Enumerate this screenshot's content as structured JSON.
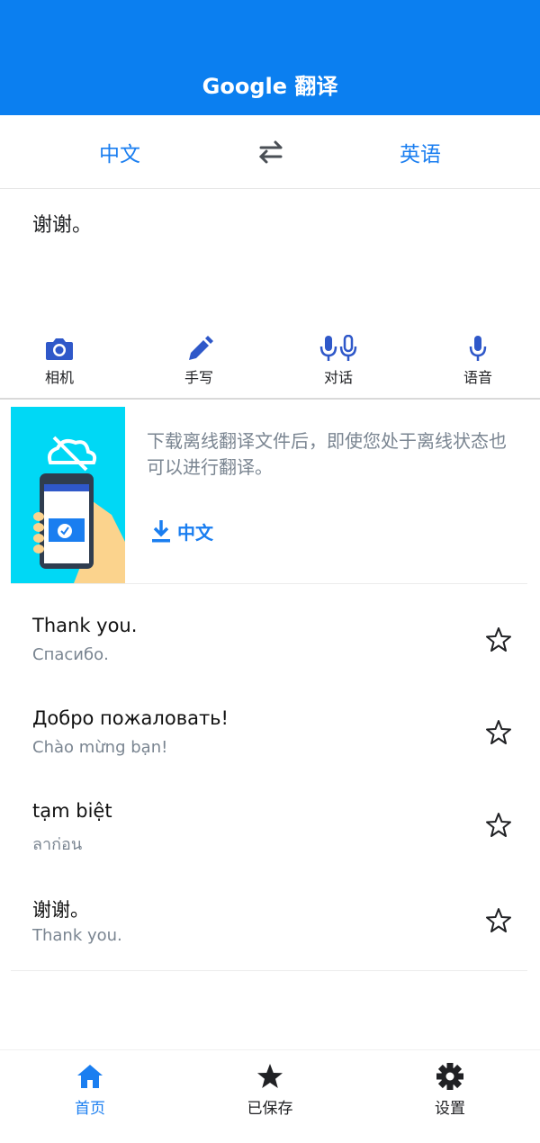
{
  "header": {
    "title": "Google 翻译",
    "color": "#0b7ff0"
  },
  "languages": {
    "source": "中文",
    "target": "英语"
  },
  "input": {
    "text": "谢谢。"
  },
  "tools": [
    {
      "label": "相机",
      "icon": "camera-icon"
    },
    {
      "label": "手写",
      "icon": "pen-icon"
    },
    {
      "label": "对话",
      "icon": "dual-mic-icon"
    },
    {
      "label": "语音",
      "icon": "mic-icon"
    }
  ],
  "offline": {
    "message": "下载离线翻译文件后，即使您处于离线状态也可以进行翻译。",
    "download_label": "中文",
    "icon": "download-icon"
  },
  "history": [
    {
      "source": "Thank you.",
      "translation": "Спасибо."
    },
    {
      "source": "Добро пожаловать!",
      "translation": "Chào mừng bạn!"
    },
    {
      "source": "tạm biệt",
      "translation": "ลาก่อน"
    },
    {
      "source": "谢谢。",
      "translation": "Thank you."
    }
  ],
  "nav": [
    {
      "label": "首页",
      "icon": "home-icon",
      "active": true
    },
    {
      "label": "已保存",
      "icon": "star-icon",
      "active": false
    },
    {
      "label": "设置",
      "icon": "gear-icon",
      "active": false
    }
  ],
  "accent_color": "#1a7ef0"
}
